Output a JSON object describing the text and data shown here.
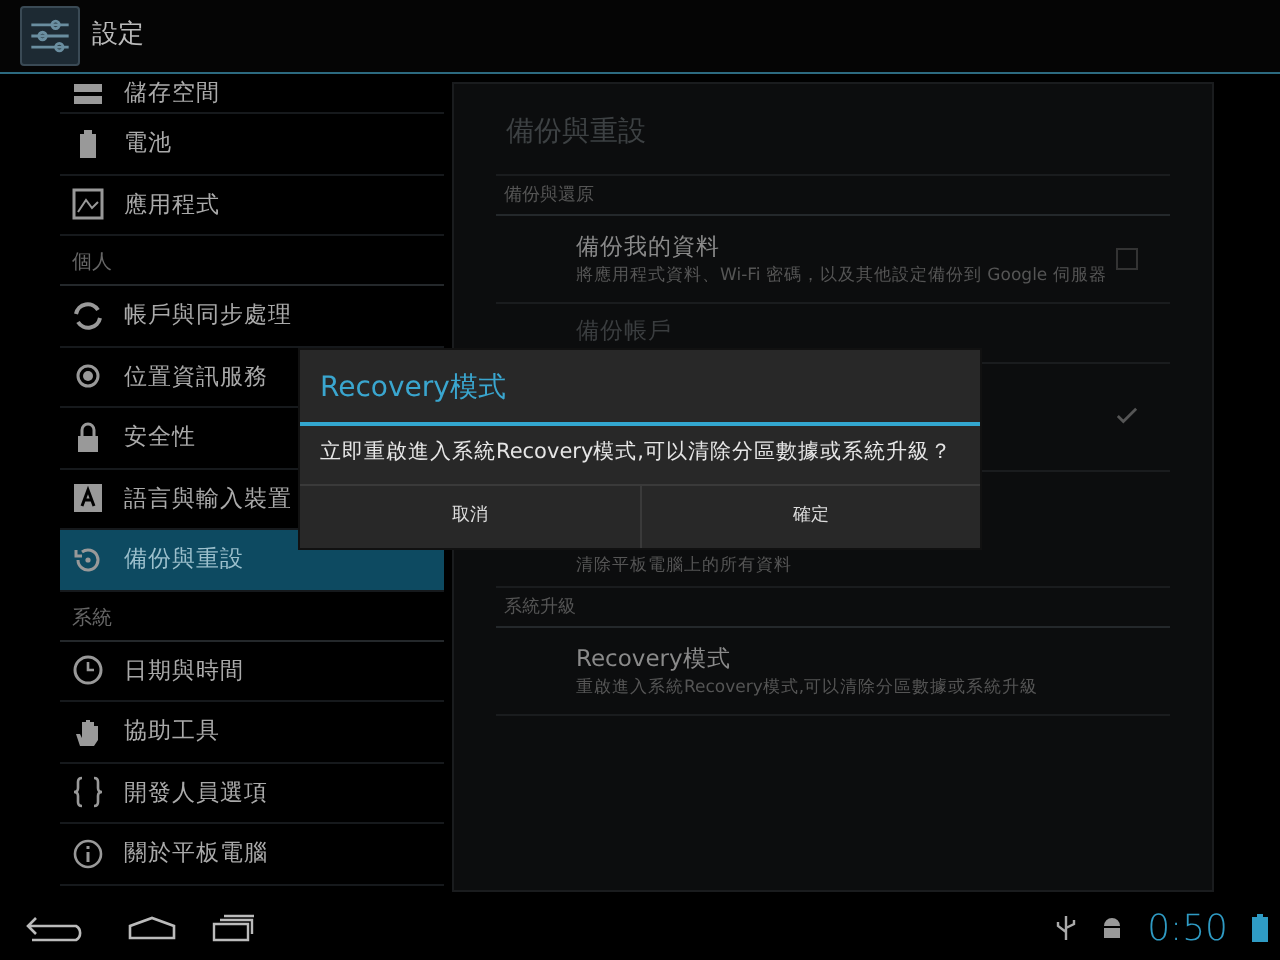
{
  "action_bar": {
    "title": "設定"
  },
  "sidebar": {
    "items": [
      {
        "kind": "item",
        "label": "儲存空間",
        "selected": false
      },
      {
        "kind": "item",
        "label": "電池",
        "selected": false
      },
      {
        "kind": "item",
        "label": "應用程式",
        "selected": false
      },
      {
        "kind": "header",
        "label": "個人"
      },
      {
        "kind": "item",
        "label": "帳戶與同步處理",
        "selected": false
      },
      {
        "kind": "item",
        "label": "位置資訊服務",
        "selected": false
      },
      {
        "kind": "item",
        "label": "安全性",
        "selected": false
      },
      {
        "kind": "item",
        "label": "語言與輸入裝置",
        "selected": false
      },
      {
        "kind": "item",
        "label": "備份與重設",
        "selected": true
      },
      {
        "kind": "header",
        "label": "系統"
      },
      {
        "kind": "item",
        "label": "日期與時間",
        "selected": false
      },
      {
        "kind": "item",
        "label": "協助工具",
        "selected": false
      },
      {
        "kind": "item",
        "label": "開發人員選項",
        "selected": false
      },
      {
        "kind": "item",
        "label": "關於平板電腦",
        "selected": false
      }
    ]
  },
  "panel": {
    "title": "備份與重設",
    "items": [
      {
        "kind": "header",
        "label": "備份與還原"
      },
      {
        "kind": "setting",
        "title": "備份我的資料",
        "summary": "將應用程式資料、Wi-Fi 密碼，以及其他設定備份到 Google 伺服器",
        "checked": false,
        "disabled": false
      },
      {
        "kind": "setting",
        "title": "備份帳戶",
        "disabled": true
      },
      {
        "kind": "setting",
        "checked": true,
        "disabled": false
      },
      {
        "kind": "setting",
        "summary": "清除平板電腦上的所有資料",
        "disabled": false
      },
      {
        "kind": "header",
        "label": "系統升級"
      },
      {
        "kind": "setting",
        "title": "Recovery模式",
        "summary": "重啟進入系統Recovery模式,可以清除分區數據或系統升級",
        "disabled": false
      }
    ]
  },
  "dialog": {
    "title": "Recovery模式",
    "message": "立即重啟進入系統Recovery模式,可以清除分區數據或系統升級？",
    "buttons": [
      "取消",
      "確定"
    ]
  },
  "status_bar": {
    "time": "0:50"
  }
}
